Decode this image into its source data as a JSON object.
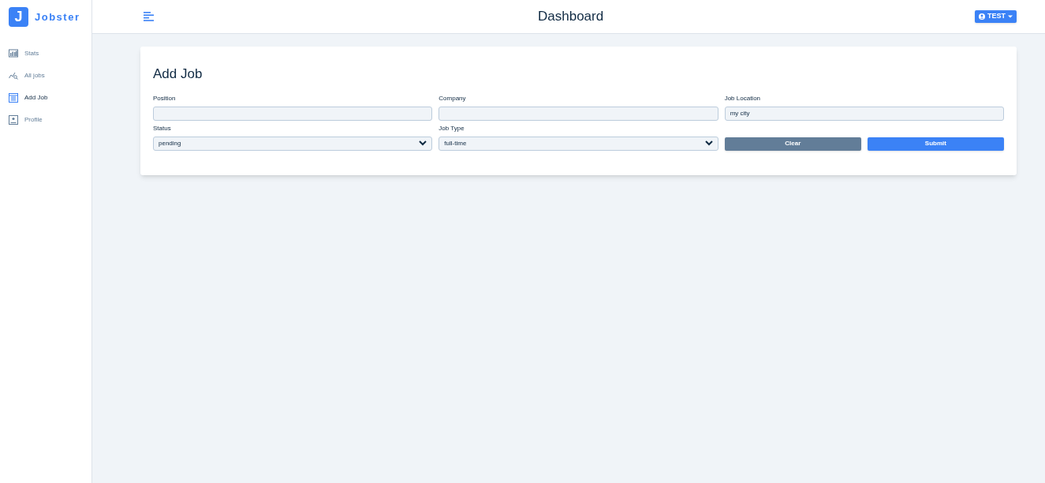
{
  "logo": {
    "letter": "J",
    "name": "Jobster"
  },
  "header": {
    "title": "Dashboard",
    "user_button": "TEST"
  },
  "sidebar": {
    "items": [
      {
        "label": "Stats",
        "kind": "bars",
        "selected": false
      },
      {
        "label": "All jobs",
        "kind": "search",
        "selected": false
      },
      {
        "label": "Add Job",
        "kind": "form",
        "selected": true
      },
      {
        "label": "Profile",
        "kind": "profile",
        "selected": false
      }
    ]
  },
  "form": {
    "title": "Add Job",
    "fields": [
      {
        "kind": "text",
        "label": "Position"
      },
      {
        "kind": "text",
        "label": "Company"
      },
      {
        "kind": "text",
        "label": "Job Location",
        "value": "my city"
      },
      {
        "kind": "select",
        "label": "Status",
        "value": "pending"
      },
      {
        "kind": "select",
        "label": "Job Type",
        "value": "full-time"
      }
    ],
    "buttons": [
      {
        "kind": "clear",
        "label": "Clear"
      },
      {
        "kind": "submit",
        "label": "Submit"
      }
    ]
  }
}
